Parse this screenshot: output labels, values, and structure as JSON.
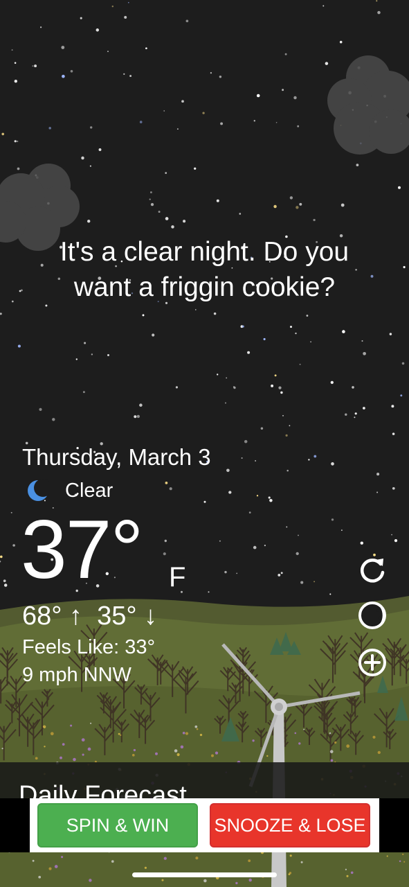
{
  "message": {
    "line1": "It's a clear night. Do you",
    "line2": "want a friggin cookie?"
  },
  "weather": {
    "date": "Thursday, March 3",
    "condition": "Clear",
    "condition_icon": "crescent-moon-icon",
    "temperature": "37°",
    "unit": "F",
    "high_low": "68° ↑  35° ↓",
    "feels_like": "Feels Like: 33°",
    "wind": "9 mph NNW"
  },
  "side_actions": [
    {
      "name": "refresh",
      "icon": "refresh-icon"
    },
    {
      "name": "moon-phase",
      "icon": "moon-phase-icon"
    },
    {
      "name": "add-location",
      "icon": "plus-circle-icon"
    }
  ],
  "forecast": {
    "title": "Daily Forecast"
  },
  "ad": {
    "spin_label": "SPIN & WIN",
    "snooze_label": "SNOOZE & LOSE"
  },
  "colors": {
    "sky": "#1d1d1d",
    "hill": "#5e6a34",
    "spin_button": "#4caf50",
    "snooze_button": "#e8352b",
    "moon_icon": "#4a90e2"
  }
}
